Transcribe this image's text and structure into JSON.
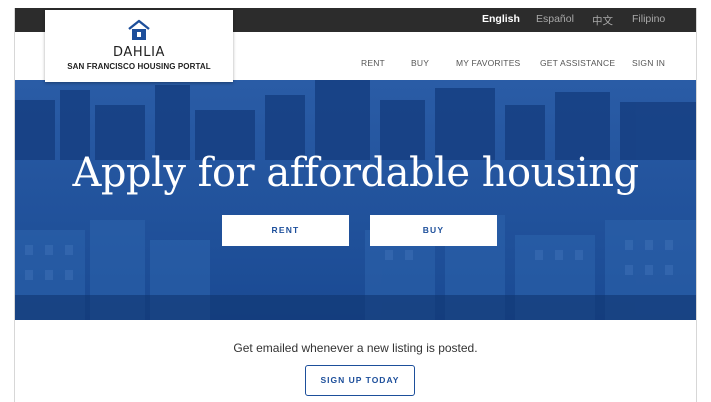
{
  "languages": [
    {
      "label": "English",
      "active": true
    },
    {
      "label": "Español",
      "active": false
    },
    {
      "label": "中文",
      "active": false
    },
    {
      "label": "Filipino",
      "active": false
    }
  ],
  "logo": {
    "title": "DAHLIA",
    "subtitle": "SAN FRANCISCO HOUSING PORTAL",
    "icon": "house-icon"
  },
  "nav": {
    "items": [
      "RENT",
      "BUY",
      "MY FAVORITES",
      "GET ASSISTANCE",
      "SIGN IN"
    ]
  },
  "hero": {
    "title": "Apply for affordable housing",
    "rent_button": "RENT",
    "buy_button": "BUY"
  },
  "signup": {
    "text": "Get emailed whenever a new listing is posted.",
    "button": "SIGN UP TODAY"
  },
  "colors": {
    "brand_blue": "#1d4f9b",
    "topbar": "#2c2c2c"
  }
}
